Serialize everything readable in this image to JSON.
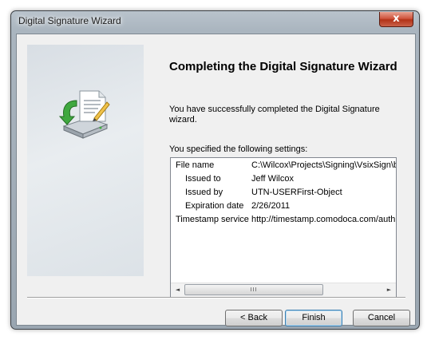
{
  "window": {
    "title": "Digital Signature Wizard",
    "close_label": "x"
  },
  "main": {
    "heading": "Completing the Digital Signature Wizard",
    "intro": "You have successfully completed the Digital Signature wizard.",
    "settings_label": "You specified the following settings:",
    "settings": [
      {
        "key": "File name",
        "value": "C:\\Wilcox\\Projects\\Signing\\VsixSign\\b"
      },
      {
        "key": "Issued to",
        "value": "Jeff Wilcox"
      },
      {
        "key": "Issued by",
        "value": "UTN-USERFirst-Object"
      },
      {
        "key": "Expiration date",
        "value": "2/26/2011"
      },
      {
        "key": "Timestamp service",
        "value": "http://timestamp.comodoca.com/auth"
      }
    ],
    "scrollbar": {
      "left_arrow": "◄",
      "right_arrow": "►",
      "grip": "III"
    }
  },
  "buttons": {
    "back": "< Back",
    "finish": "Finish",
    "cancel": "Cancel"
  },
  "icons": {
    "wizard": "certificate-document-with-green-arrow-and-drive-icon"
  }
}
